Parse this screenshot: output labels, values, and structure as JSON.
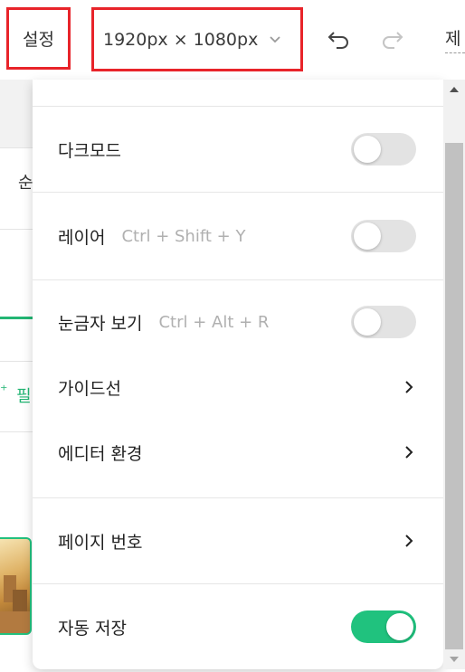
{
  "toolbar": {
    "settings_label": "설정",
    "canvas_size": "1920px × 1080px",
    "title_partial": "제"
  },
  "background": {
    "row_label_partial": "순",
    "filter_label_partial": "필"
  },
  "menu": {
    "dark_mode": {
      "label": "다크모드",
      "enabled": false
    },
    "layer": {
      "label": "레이어",
      "shortcut": "Ctrl + Shift + Y",
      "enabled": false
    },
    "ruler": {
      "label": "눈금자 보기",
      "shortcut": "Ctrl + Alt + R",
      "enabled": false
    },
    "guides": {
      "label": "가이드선"
    },
    "editor_env": {
      "label": "에디터 환경"
    },
    "page_number": {
      "label": "페이지 번호"
    },
    "autosave": {
      "label": "자동 저장",
      "enabled": true
    }
  },
  "colors": {
    "highlight_border": "#e8242a",
    "toggle_on": "#20c27e",
    "toggle_off": "#e3e3e3",
    "accent_green": "#22b573"
  },
  "icons": [
    "chevron-down-icon",
    "undo-icon",
    "redo-icon",
    "chevron-right-icon",
    "sparkle-icon",
    "scroll-up-arrow-icon",
    "scroll-down-arrow-icon"
  ]
}
